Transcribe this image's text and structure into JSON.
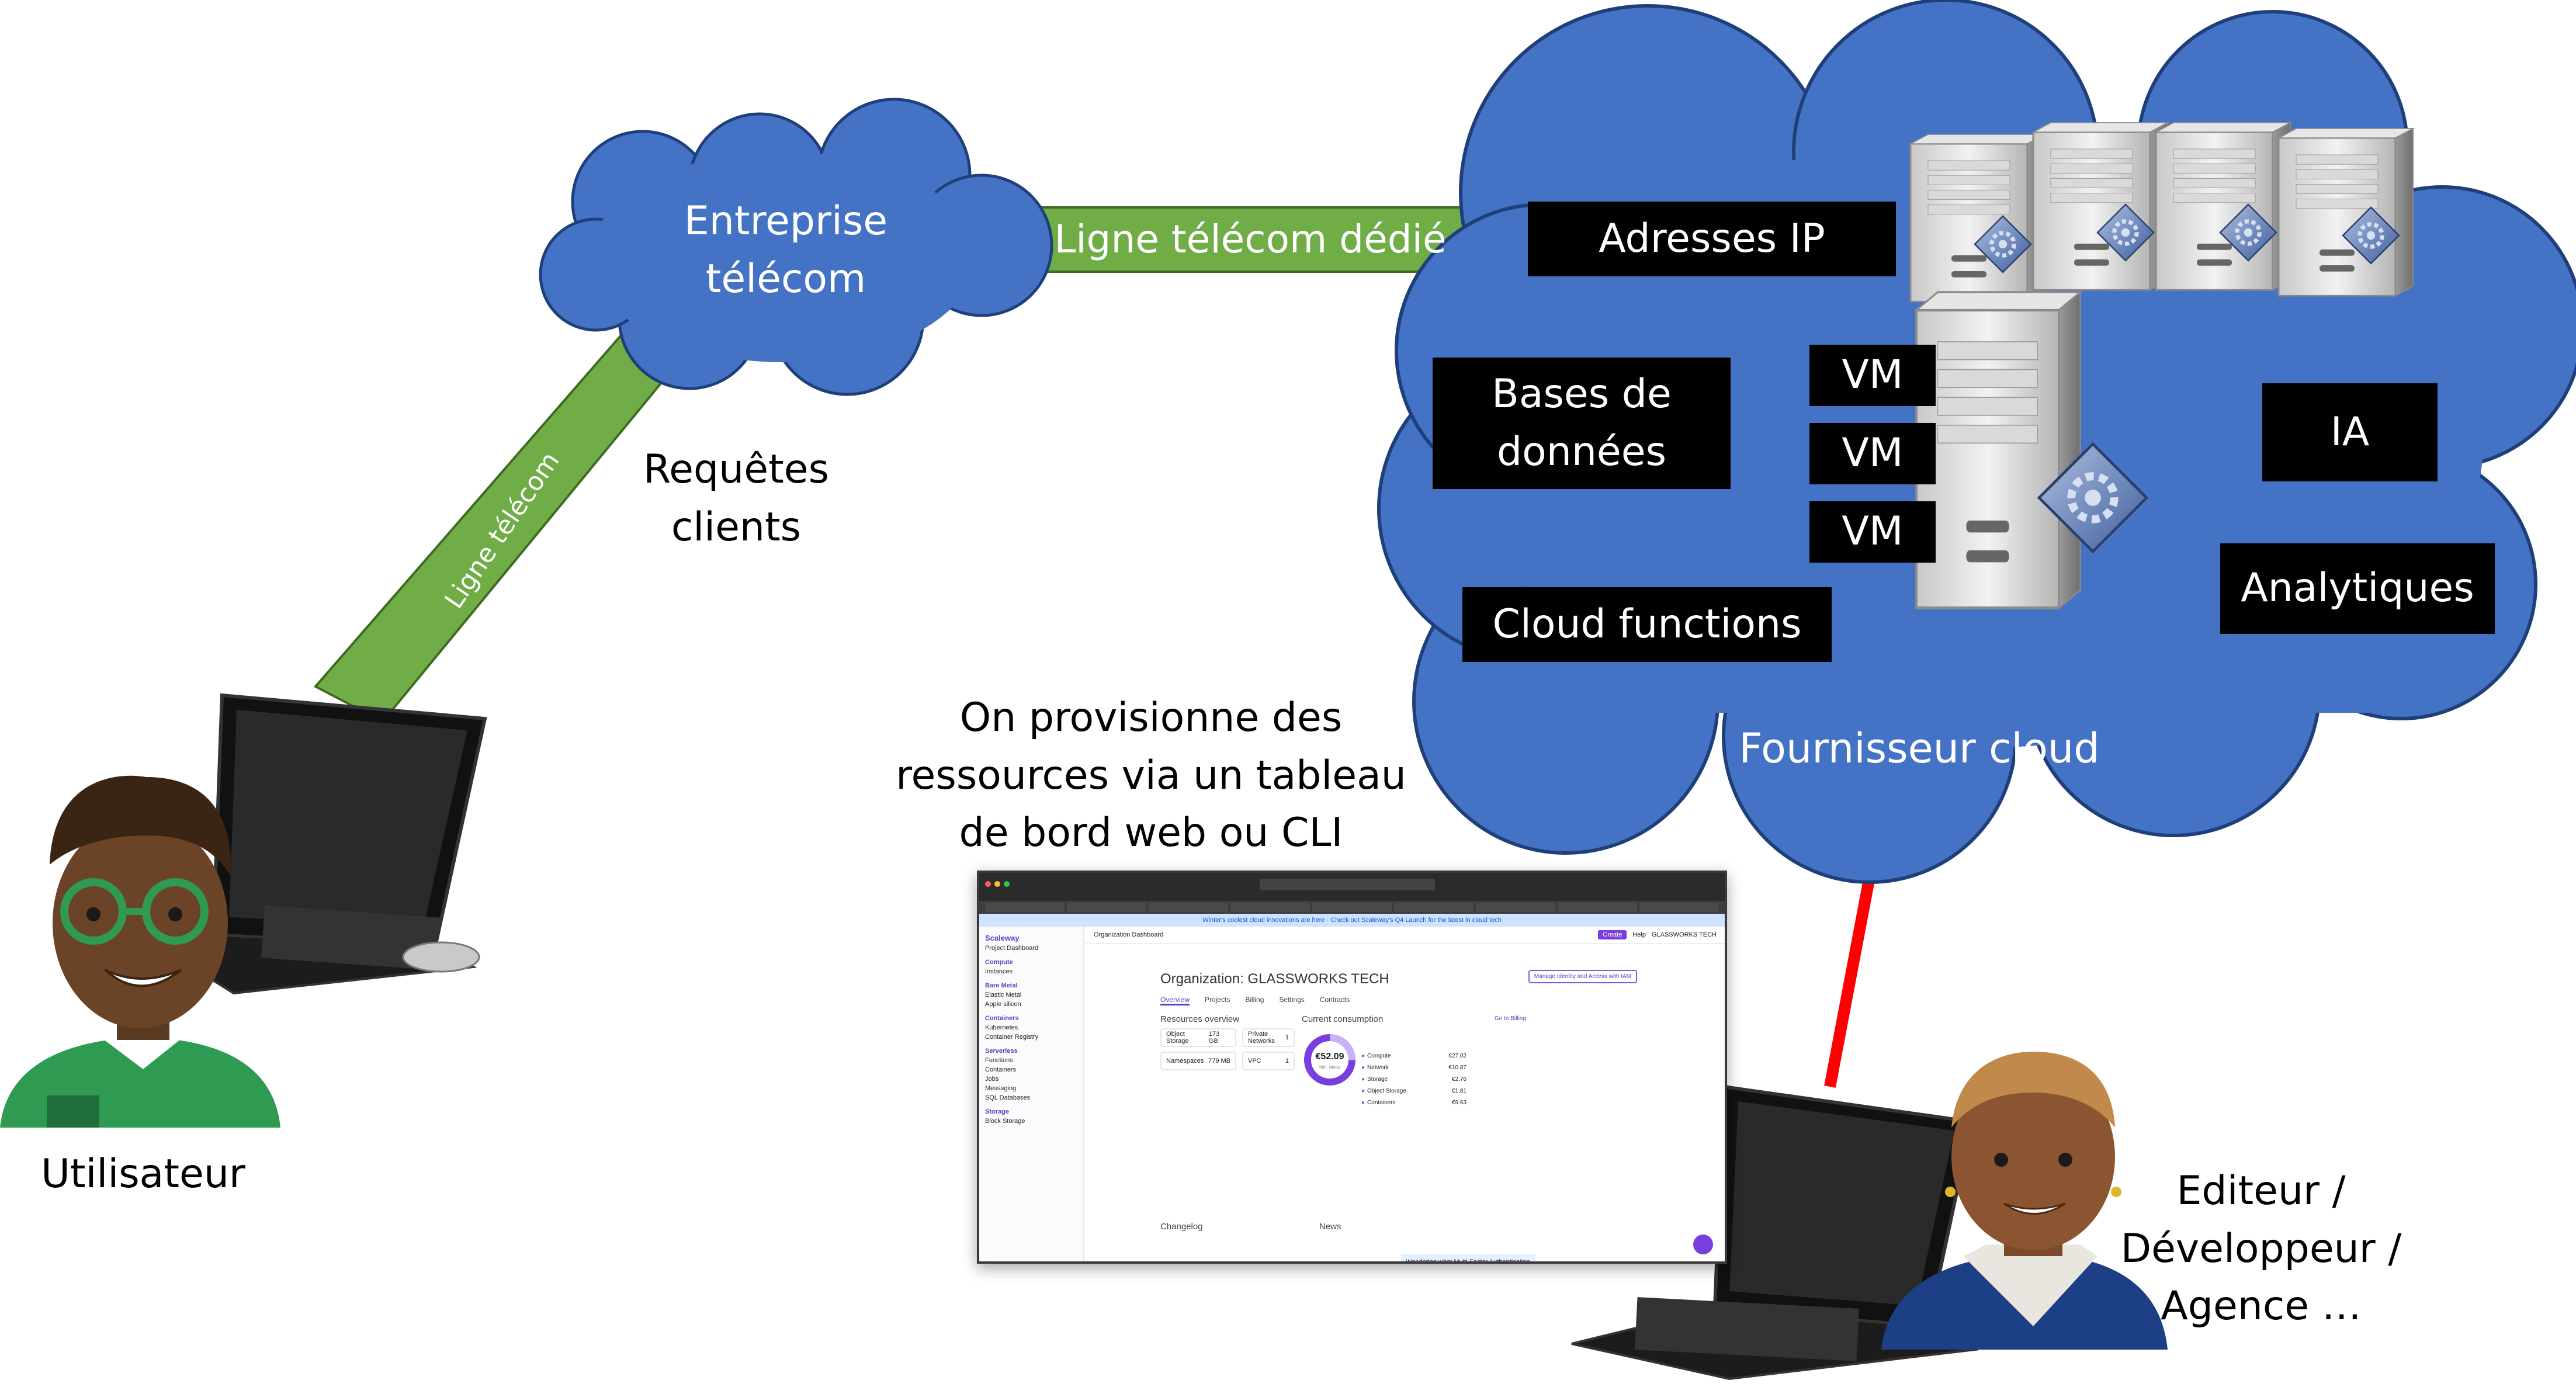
{
  "labels": {
    "entreprise": "Entreprise\ntélécom",
    "ligne_dedie": "Ligne télécom dédié",
    "ligne": "Ligne télécom",
    "requetes": "Requêtes\nclients",
    "utilisateur": "Utilisateur",
    "provision": "On provisionne des\nressources via un tableau\nde bord web ou CLI",
    "fournisseur": "Fournisseur cloud",
    "editeur": "Editeur /\nDéveloppeur /\nAgence …"
  },
  "services": {
    "adresses_ip": "Adresses IP",
    "bases": "Bases de\ndonnées",
    "vm1": "VM",
    "vm2": "VM",
    "vm3": "VM",
    "ia": "IA",
    "cloud_functions": "Cloud functions",
    "analytiques": "Analytiques"
  },
  "colors": {
    "cloud_blue": "#4472c4",
    "cloud_border": "#1f3f7a",
    "line_green": "#70ad47",
    "arrow_red": "#ff0000",
    "label_bg": "#000000",
    "label_text": "#ffffff"
  },
  "icons": {
    "server": "server-icon",
    "laptop": "laptop-icon",
    "user_man": "man-avatar-icon",
    "user_woman": "woman-avatar-icon"
  },
  "dashboard": {
    "brand": "Scaleway",
    "banner": "Winter's coolest cloud innovations are here · Check out Scaleway's Q4 Launch for the latest in cloud tech",
    "breadcrumb": "Organization Dashboard",
    "title": "Organization: GLASSWORKS TECH",
    "manage_button": "Manage Identity and Access with IAM",
    "tabs": [
      "Overview",
      "Projects",
      "Billing",
      "Settings",
      "Contracts"
    ],
    "resources_title": "Resources overview",
    "consumption_title": "Current consumption",
    "go_billing": "Go to Billing",
    "total": "€52.09",
    "total_caption": "Incl. taxes",
    "resources": [
      {
        "name": "Object Storage",
        "value": "173 GB"
      },
      {
        "name": "Private Networks",
        "value": "1"
      },
      {
        "name": "Namespaces",
        "value": "779 MB"
      },
      {
        "name": "VPC",
        "value": "1"
      }
    ],
    "consumption": [
      {
        "name": "Compute",
        "value": "€27.02"
      },
      {
        "name": "Network",
        "value": "€10.87"
      },
      {
        "name": "Storage",
        "value": "€2.76"
      },
      {
        "name": "Object Storage",
        "value": "€1.81"
      },
      {
        "name": "Containers",
        "value": "€9.63"
      }
    ],
    "sidebar": [
      "Project Dashboard",
      "Compute",
      "Instances",
      "Bare Metal",
      "Elastic Metal",
      "Apple silicon",
      "Containers",
      "Kubernetes",
      "Container Registry",
      "Serverless",
      "Functions",
      "Containers",
      "Jobs",
      "Messaging",
      "SQL Databases",
      "Storage",
      "Block Storage"
    ],
    "changelog": "Changelog",
    "news_title": "News",
    "news_card": "Wondering what Multi-Factor Authentication (MFA) is?",
    "help": "Help",
    "create": "Create",
    "org_short": "GLASSWORKS TECH"
  }
}
